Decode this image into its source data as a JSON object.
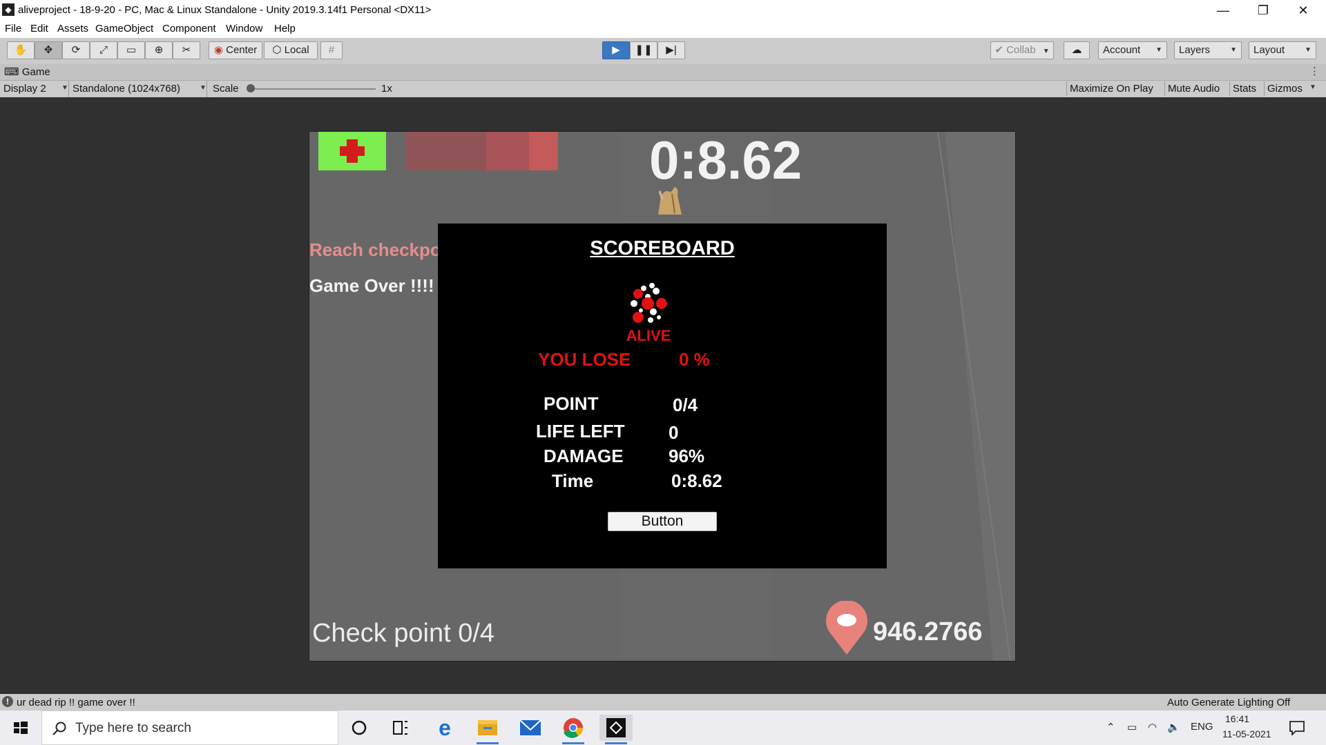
{
  "window": {
    "title": "aliveproject - 18-9-20 - PC, Mac & Linux Standalone - Unity 2019.3.14f1 Personal <DX11>",
    "minimize_glyph": "—",
    "maximize_glyph": "❐",
    "close_glyph": "✕"
  },
  "menu": {
    "items": [
      "File",
      "Edit",
      "Assets",
      "GameObject",
      "Component",
      "Window",
      "Help"
    ]
  },
  "toolbar": {
    "center_label": "Center",
    "local_label": "Local",
    "collab_label": "Collab",
    "account_label": "Account",
    "layers_label": "Layers",
    "layout_label": "Layout"
  },
  "game_tab": {
    "label": "Game",
    "display": "Display 2",
    "resolution": "Standalone (1024x768)",
    "scale_label": "Scale",
    "scale_value": "1x",
    "scale_level": 0,
    "maximize_on_play": "Maximize On Play",
    "mute_audio": "Mute Audio",
    "stats": "Stats",
    "gizmos": "Gizmos"
  },
  "hud": {
    "timer": "0:8.62",
    "reach_text": "Reach checkpo",
    "game_over_text": "Game Over !!!!",
    "checkpoint_text": "Check point 0/4",
    "distance": "946.2766",
    "health_color": "#7cee4f",
    "damage_color": "#c45a5a"
  },
  "scoreboard": {
    "title": "SCOREBOARD",
    "logo_text": "ALIVE",
    "result_label": "YOU LOSE",
    "result_value": "0 %",
    "rows": [
      {
        "label": "POINT",
        "value": "0/4"
      },
      {
        "label": "LIFE LEFT",
        "value": "0"
      },
      {
        "label": "DAMAGE",
        "value": "96%"
      },
      {
        "label": "Time",
        "value": "0:8.62"
      }
    ],
    "button_label": "Button"
  },
  "status": {
    "message": "ur dead rip !! game over !!",
    "right_text": "Auto Generate Lighting Off"
  },
  "taskbar": {
    "search_placeholder": "Type here to search",
    "language": "ENG",
    "time": "16:41",
    "date": "11-05-2021"
  },
  "colors": {
    "accent": "#3a78c2",
    "lose_red": "#e01212",
    "editor_gray": "#cbcbcb"
  }
}
